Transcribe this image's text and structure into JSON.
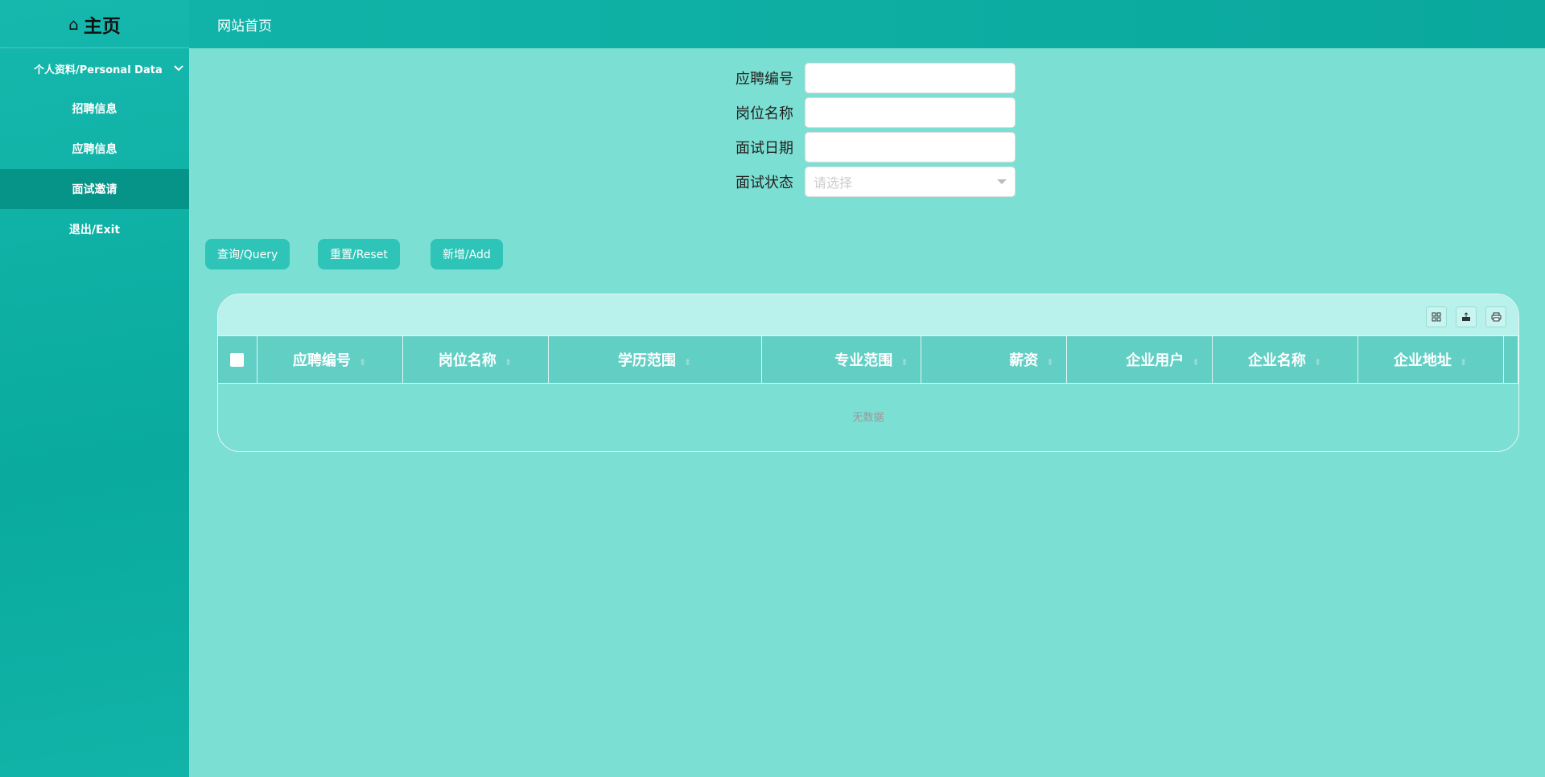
{
  "sidebar": {
    "logo_text": "主页",
    "items": [
      {
        "label": "个人资料/Personal Data"
      },
      {
        "label": "招聘信息"
      },
      {
        "label": "应聘信息"
      },
      {
        "label": "面试邀请"
      },
      {
        "label": "退出/Exit"
      }
    ]
  },
  "topbar": {
    "title": "网站首页"
  },
  "search": {
    "fields": [
      {
        "label": "应聘编号",
        "value": ""
      },
      {
        "label": "岗位名称",
        "value": ""
      },
      {
        "label": "面试日期",
        "value": ""
      },
      {
        "label": "面试状态",
        "placeholder": "请选择"
      }
    ]
  },
  "buttons": {
    "query": "查询/Query",
    "reset": "重置/Reset",
    "add": "新增/Add"
  },
  "table": {
    "columns": [
      "应聘编号",
      "岗位名称",
      "学历范围",
      "专业范围",
      "薪资",
      "企业用户",
      "企业名称",
      "企业地址"
    ],
    "empty_text": "无数据"
  },
  "colors": {
    "accent": "#2ec4b8",
    "sidebar": "#0aaa9e",
    "background": "#7cdfd3"
  }
}
